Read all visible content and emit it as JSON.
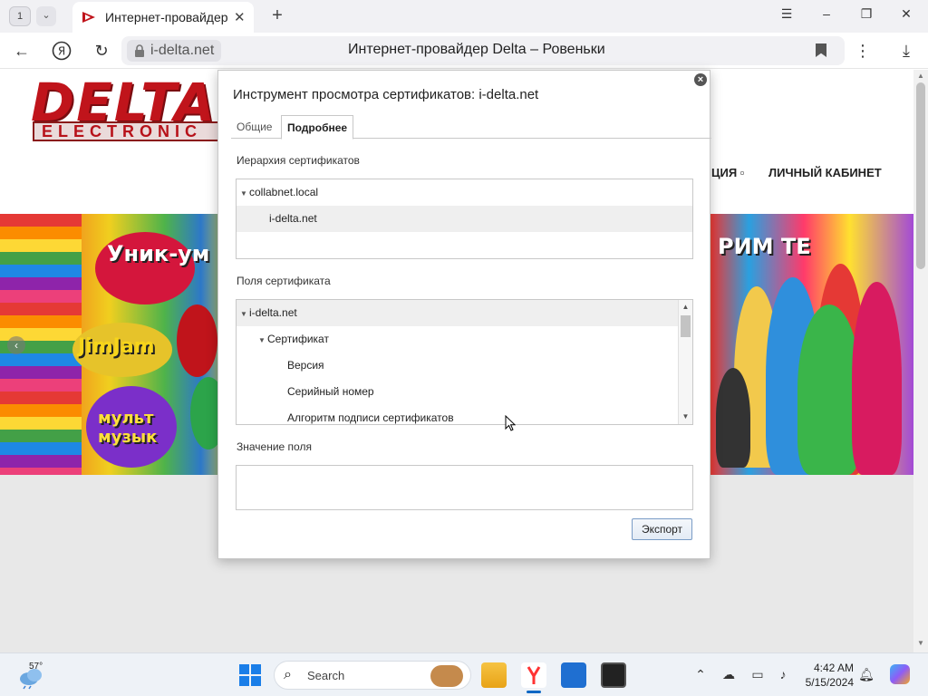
{
  "browser": {
    "tab_counter": "1",
    "tab_title": "Интернет-провайдер D",
    "tab_close": "✕",
    "new_tab": "+",
    "window_controls": {
      "minimize": "–",
      "restore": "❐",
      "close": "✕",
      "menu": "☰"
    },
    "address_domain": "i-delta.net",
    "page_title": "Интернет-провайдер Delta – Ровеньки",
    "icons": [
      "back-icon",
      "yandex-icon",
      "reload-icon",
      "lock-icon",
      "bookmark-icon",
      "more-icon",
      "download-icon"
    ]
  },
  "website": {
    "logo_main": "DELTA",
    "logo_sub": "ELECTRONIC",
    "menu": {
      "item1": "ЦИЯ ▫",
      "item2": "ЛИЧНЫЙ КАБИНЕТ"
    },
    "banner_words": {
      "w1": "Уник-ум",
      "w2": "JimJam",
      "w3": "мульт музык",
      "w4": "РИМ ТЕ"
    }
  },
  "dialog": {
    "title": "Инструмент просмотра сертификатов: i-delta.net",
    "close_icon": "×",
    "tabs": [
      {
        "label": "Общие",
        "active": false
      },
      {
        "label": "Подробнее",
        "active": true
      }
    ],
    "hierarchy_label": "Иерархия сертификатов",
    "hierarchy": [
      {
        "label": "collabnet.local",
        "expanded": true,
        "selected": false
      },
      {
        "label": "i-delta.net",
        "selected": true
      }
    ],
    "fields_label": "Поля сертификата",
    "fields": [
      {
        "label": "i-delta.net",
        "expanded": true
      },
      {
        "label": "Сертификат",
        "expanded": true
      },
      {
        "label": "Версия"
      },
      {
        "label": "Серийный номер"
      },
      {
        "label": "Алгоритм подписи сертификатов"
      }
    ],
    "value_label": "Значение поля",
    "field_value": "",
    "export_button": "Экспорт"
  },
  "taskbar": {
    "weather_temp": "57°",
    "search_placeholder": "Search",
    "clock_time": "4:42 AM",
    "clock_date": "5/15/2024",
    "apps": [
      "start-icon",
      "search-icon",
      "file-explorer-icon",
      "yandex-browser-icon",
      "store-icon",
      "terminal-icon"
    ],
    "tray": [
      "chevron-up-icon",
      "cloud-off-icon",
      "display-icon",
      "volume-icon",
      "notification-bell-icon",
      "copilot-icon"
    ]
  },
  "colors": {
    "accent": "#0b67c4",
    "logo_red": "#c0141b",
    "dialog_border": "#c8c8c8"
  }
}
